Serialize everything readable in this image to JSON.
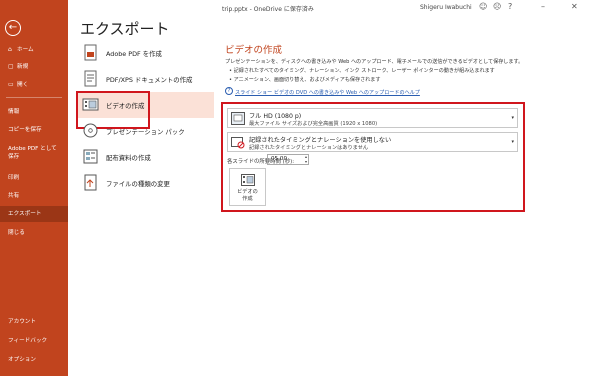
{
  "titlebar": {
    "doc_title": "trip.pptx  -  OneDrive に保存済み",
    "user": "Shigeru Iwabuchi",
    "icons": [
      "smiley-icon",
      "frown-icon",
      "help-icon",
      "minimize-icon",
      "close-icon"
    ]
  },
  "sidebar": {
    "items": [
      {
        "label": "ホーム",
        "icon": "home-icon"
      },
      {
        "label": "新規",
        "icon": "new-icon"
      },
      {
        "label": "開く",
        "icon": "open-icon"
      },
      {
        "label": "情報"
      },
      {
        "label": "コピーを保存"
      },
      {
        "label": "Adobe PDF として保存"
      },
      {
        "label": "印刷"
      },
      {
        "label": "共有"
      },
      {
        "label": "エクスポート"
      },
      {
        "label": "閉じる"
      },
      {
        "label": "アカウント"
      },
      {
        "label": "フィードバック"
      },
      {
        "label": "オプション"
      }
    ]
  },
  "main": {
    "page_title": "エクスポート",
    "menu": [
      {
        "label": "Adobe PDF を作成"
      },
      {
        "label": "PDF/XPS ドキュメントの作成"
      },
      {
        "label": "ビデオの作成"
      },
      {
        "label": "プレゼンテーション パック"
      },
      {
        "label": "配布資料の作成"
      },
      {
        "label": "ファイルの種類の変更"
      }
    ]
  },
  "video": {
    "title": "ビデオの作成",
    "desc": "プレゼンテーションを、ディスクへの書き込みや Web へのアップロード、電子メールでの送信ができるビデオとして保存します。",
    "bullets": [
      "記録されたすべてのタイミング、ナレーション、インク ストローク、レーザー ポインターの動きが組み込まれます",
      "アニメーション、画面切り替え、およびメディアも保存されます"
    ],
    "help_link": "スライド ショー ビデオの DVD への書き込みや Web へのアップロードのヘルプ",
    "quality": {
      "main": "フル HD (1080 p)",
      "sub": "最大ファイル サイズおよび完全高画質 (1920 x 1080)"
    },
    "timing": {
      "main": "記録されたタイミングとナレーションを使用しない",
      "sub": "記録されたタイミングとナレーションはありません"
    },
    "time_label": "各スライドの所要時間 (秒):",
    "time_value": "05.00",
    "create_label_1": "ビデオの",
    "create_label_2": "作成"
  }
}
